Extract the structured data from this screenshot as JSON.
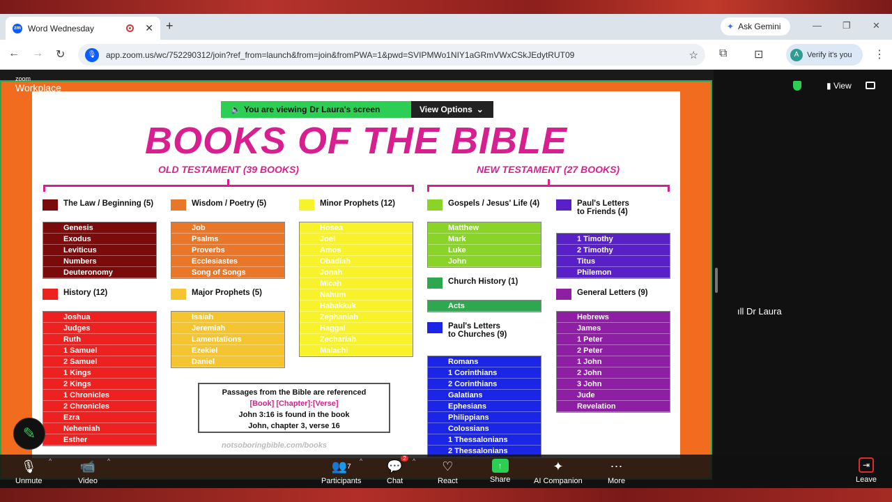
{
  "browser": {
    "tab_title": "Word Wednesday",
    "new_tab": "+",
    "tab_close": "✕",
    "favicon": "zm",
    "gemini": "Ask Gemini",
    "window_controls": [
      "—",
      "❐",
      "✕"
    ],
    "url": "app.zoom.us/wc/752290312/join?ref_from=launch&from=join&fromPWA=1&pwd=SVIPMWo1NIY1aGRmVWxCSkJEdytRUT09",
    "verify": "Verify it's you",
    "verify_avatar": "A"
  },
  "zoom": {
    "logo_small": "zoom",
    "logo_text": "Workplace",
    "viewing_prefix": "You are viewing",
    "viewing_name": "Dr Laura's screen",
    "view_options": "View Options",
    "view_button": "View",
    "participant_label": "Dr Laura",
    "toolbar": {
      "unmute": "Unmute",
      "video": "Video",
      "participants": "Participants",
      "participants_count": "7",
      "chat": "Chat",
      "chat_badge": "2",
      "react": "React",
      "share": "Share",
      "ai": "AI Companion",
      "more": "More",
      "leave": "Leave"
    }
  },
  "slide": {
    "title": "BOOKS OF THE BIBLE",
    "old_testament": "OLD TESTAMENT (39 BOOKS)",
    "new_testament": "NEW TESTAMENT (27 BOOKS)",
    "law": {
      "label": "The Law / Beginning (5)",
      "color": "#7b0a0a",
      "books": [
        "Genesis",
        "Exodus",
        "Leviticus",
        "Numbers",
        "Deuteronomy"
      ]
    },
    "history": {
      "label": "History (12)",
      "color": "#ee2121",
      "books": [
        "Joshua",
        "Judges",
        "Ruth",
        "1 Samuel",
        "2 Samuel",
        "1 Kings",
        "2 Kings",
        "1 Chronicles",
        "2 Chronicles",
        "Ezra",
        "Nehemiah",
        "Esther"
      ]
    },
    "wisdom": {
      "label": "Wisdom / Poetry (5)",
      "color": "#e9772a",
      "books": [
        "Job",
        "Psalms",
        "Proverbs",
        "Ecclesiastes",
        "Song of Songs"
      ]
    },
    "major": {
      "label": "Major Prophets (5)",
      "color": "#f4c431",
      "books": [
        "Isaiah",
        "Jeremiah",
        "Lamentations",
        "Ezekiel",
        "Daniel"
      ]
    },
    "minor": {
      "label": "Minor Prophets (12)",
      "color": "#f7f22a",
      "books": [
        "Hosea",
        "Joel",
        "Amos",
        "Obadiah",
        "Jonah",
        "Micah",
        "Nahum",
        "Habakkuk",
        "Zephaniah",
        "Haggai",
        "Zechariah",
        "Malachi"
      ]
    },
    "gospels": {
      "label": "Gospels / Jesus' Life (4)",
      "color": "#8ad42a",
      "books": [
        "Matthew",
        "Mark",
        "Luke",
        "John"
      ]
    },
    "church": {
      "label": "Church History (1)",
      "color": "#2ea84e",
      "books": [
        "Acts"
      ]
    },
    "churches": {
      "label1": "Paul's Letters",
      "label2": "to Churches (9)",
      "color": "#1b25e6",
      "books": [
        "Romans",
        "1 Corinthians",
        "2 Corinthians",
        "Galatians",
        "Ephesians",
        "Philippians",
        "Colossians",
        "1 Thessalonians",
        "2 Thessalonians"
      ]
    },
    "friends": {
      "label1": "Paul's Letters",
      "label2": "to Friends (4)",
      "color": "#5a20c8",
      "books": [
        "1 Timothy",
        "2 Timothy",
        "Titus",
        "Philemon"
      ]
    },
    "general": {
      "label": "General Letters (9)",
      "color": "#8e1ea3",
      "books": [
        "Hebrews",
        "James",
        "1 Peter",
        "2 Peter",
        "1 John",
        "2 John",
        "3 John",
        "Jude",
        "Revelation"
      ]
    },
    "passage": {
      "line1": "Passages from the Bible are referenced",
      "line2": "[Book] [Chapter]:[Verse]",
      "line3": "John 3:16 is found in the book",
      "line4": "John, chapter 3, verse 16"
    },
    "site": "notsoboringbible.com/books"
  }
}
